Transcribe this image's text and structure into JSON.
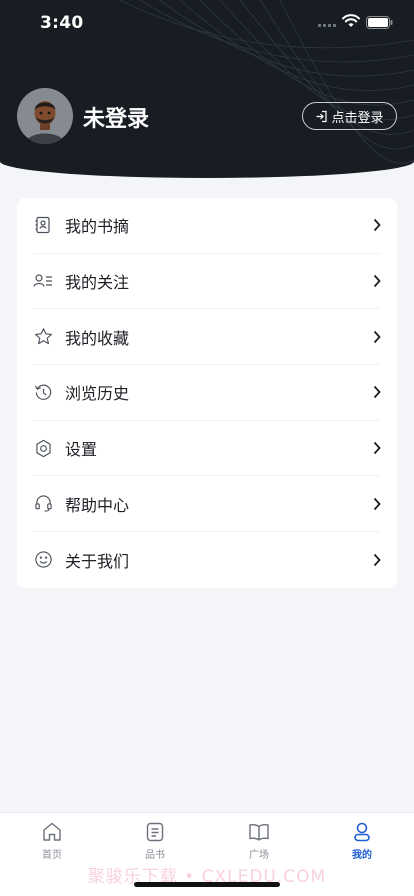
{
  "status_bar": {
    "time": "3:40"
  },
  "header": {
    "title": "未登录",
    "login_button": "点击登录"
  },
  "menu": [
    {
      "label": "我的书摘",
      "icon": "book-excerpt-icon"
    },
    {
      "label": "我的关注",
      "icon": "follow-list-icon"
    },
    {
      "label": "我的收藏",
      "icon": "star-icon"
    },
    {
      "label": "浏览历史",
      "icon": "history-icon"
    },
    {
      "label": "设置",
      "icon": "gear-icon"
    },
    {
      "label": "帮助中心",
      "icon": "headset-icon"
    },
    {
      "label": "关于我们",
      "icon": "smiley-icon"
    }
  ],
  "tabbar": {
    "tabs": [
      {
        "label": "首页",
        "icon": "home-icon"
      },
      {
        "label": "品书",
        "icon": "document-icon"
      },
      {
        "label": "广场",
        "icon": "open-book-icon"
      },
      {
        "label": "我的",
        "icon": "user-icon",
        "active": true
      }
    ]
  },
  "watermark": "聚骏乐下载 • CXLEDU.COM",
  "colors": {
    "header_bg": "#181d23",
    "accent": "#1f5fd1",
    "page_bg": "#f4f5f8"
  }
}
